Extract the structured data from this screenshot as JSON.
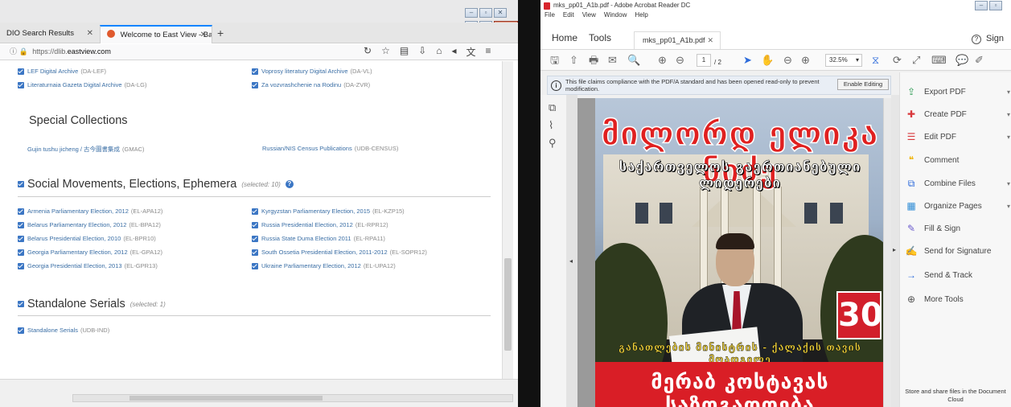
{
  "browser": {
    "tabs": [
      {
        "label": "DIO Search Results"
      },
      {
        "label": "Welcome to East View - Ba..."
      }
    ],
    "new_tab": "+",
    "url": {
      "scheme": "https://dlib.",
      "host": "eastview.com"
    },
    "top_collections": [
      {
        "name": "LEF Digital Archive",
        "code": "(DA-LEF)"
      },
      {
        "name": "Voprosy literatury Digital Archive",
        "code": "(DA-VL)"
      },
      {
        "name": "Literaturnaia Gazeta Digital Archive",
        "code": "(DA-LG)"
      },
      {
        "name": "Za vozvrashchenie na Rodinu",
        "code": "(DA-ZVR)"
      }
    ],
    "special_collections": {
      "title": "Special Collections",
      "items": [
        {
          "name": "Gujin tushu jicheng / 古今圖書集成",
          "code": "(GMAC)"
        },
        {
          "name": "Russian/NIS Census Publications",
          "code": "(UDB-CENSUS)"
        }
      ]
    },
    "social_movements": {
      "title": "Social Movements, Elections, Ephemera",
      "selected": "(selected: 10)",
      "help": "?",
      "items": [
        {
          "name": "Armenia Parliamentary Election, 2012",
          "code": "(EL-APA12)"
        },
        {
          "name": "Kyrgyzstan Parliamentary Election, 2015",
          "code": "(EL-KZP15)"
        },
        {
          "name": "Belarus Parliamentary Election, 2012",
          "code": "(EL-BPA12)"
        },
        {
          "name": "Russia Presidential Election, 2012",
          "code": "(EL-RPR12)"
        },
        {
          "name": "Belarus Presidential Election, 2010",
          "code": "(EL-BPR10)"
        },
        {
          "name": "Russia State Duma Election 2011",
          "code": "(EL-RPA11)"
        },
        {
          "name": "Georgia Parliamentary Election, 2012",
          "code": "(EL-GPA12)"
        },
        {
          "name": "South Ossetia Presidential Election, 2011-2012",
          "code": "(EL-SOPR12)"
        },
        {
          "name": "Georgia Presidential Election, 2013",
          "code": "(EL-GPR13)"
        },
        {
          "name": "Ukraine Parliamentary Election, 2012",
          "code": "(EL-UPA12)"
        }
      ]
    },
    "standalone": {
      "title": "Standalone Serials",
      "selected": "(selected: 1)",
      "items": [
        {
          "name": "Standalone Serials",
          "code": "(UDB-IND)"
        }
      ]
    }
  },
  "acrobat": {
    "window_title": "mks_pp01_A1b.pdf - Adobe Acrobat Reader DC",
    "menu": [
      "File",
      "Edit",
      "View",
      "Window",
      "Help"
    ],
    "tabs": {
      "home": "Home",
      "tools": "Tools",
      "doc": "mks_pp01_A1b.pdf"
    },
    "sign": "Sign",
    "page": {
      "current": "1",
      "total": "/ 2"
    },
    "zoom": "32.5%",
    "notice": "This file claims compliance with the PDF/A standard and has been opened read-only to prevent modification.",
    "enable_editing": "Enable Editing",
    "tools": [
      {
        "label": "Export PDF",
        "icon": "export-pdf-icon",
        "color": "#2e9b54",
        "glyph": "⇪"
      },
      {
        "label": "Create PDF",
        "icon": "create-pdf-icon",
        "color": "#d8373b",
        "glyph": "✚"
      },
      {
        "label": "Edit PDF",
        "icon": "edit-pdf-icon",
        "color": "#d8373b",
        "glyph": "☰"
      },
      {
        "label": "Comment",
        "icon": "comment-icon",
        "color": "#f0b400",
        "glyph": "💬"
      },
      {
        "label": "Combine Files",
        "icon": "combine-files-icon",
        "color": "#2d6bdb",
        "glyph": "⧉"
      },
      {
        "label": "Organize Pages",
        "icon": "organize-pages-icon",
        "color": "#2d8bd5",
        "glyph": "▦"
      },
      {
        "label": "Fill & Sign",
        "icon": "fill-sign-icon",
        "color": "#6a5acd",
        "glyph": "✎"
      },
      {
        "label": "Send for Signature",
        "icon": "send-signature-icon",
        "color": "#2d6bdb",
        "glyph": "✍"
      },
      {
        "label": "Send & Track",
        "icon": "send-track-icon",
        "color": "#2d6bdb",
        "glyph": "→"
      },
      {
        "label": "More Tools",
        "icon": "more-tools-icon",
        "color": "#555555",
        "glyph": "⊕"
      }
    ],
    "store": "Store and share files in the Document Cloud",
    "poster": {
      "headline": "მილორდ ელიკა ნიძე",
      "subheadline": "საქართველოს გაერთიანებული ლიდერები",
      "number": "30",
      "tagline": "განათლების მინისტრის - ქალაქის თავის მოადგილე",
      "footer": "მერაბ კოსტავას საზოგადოება"
    }
  }
}
